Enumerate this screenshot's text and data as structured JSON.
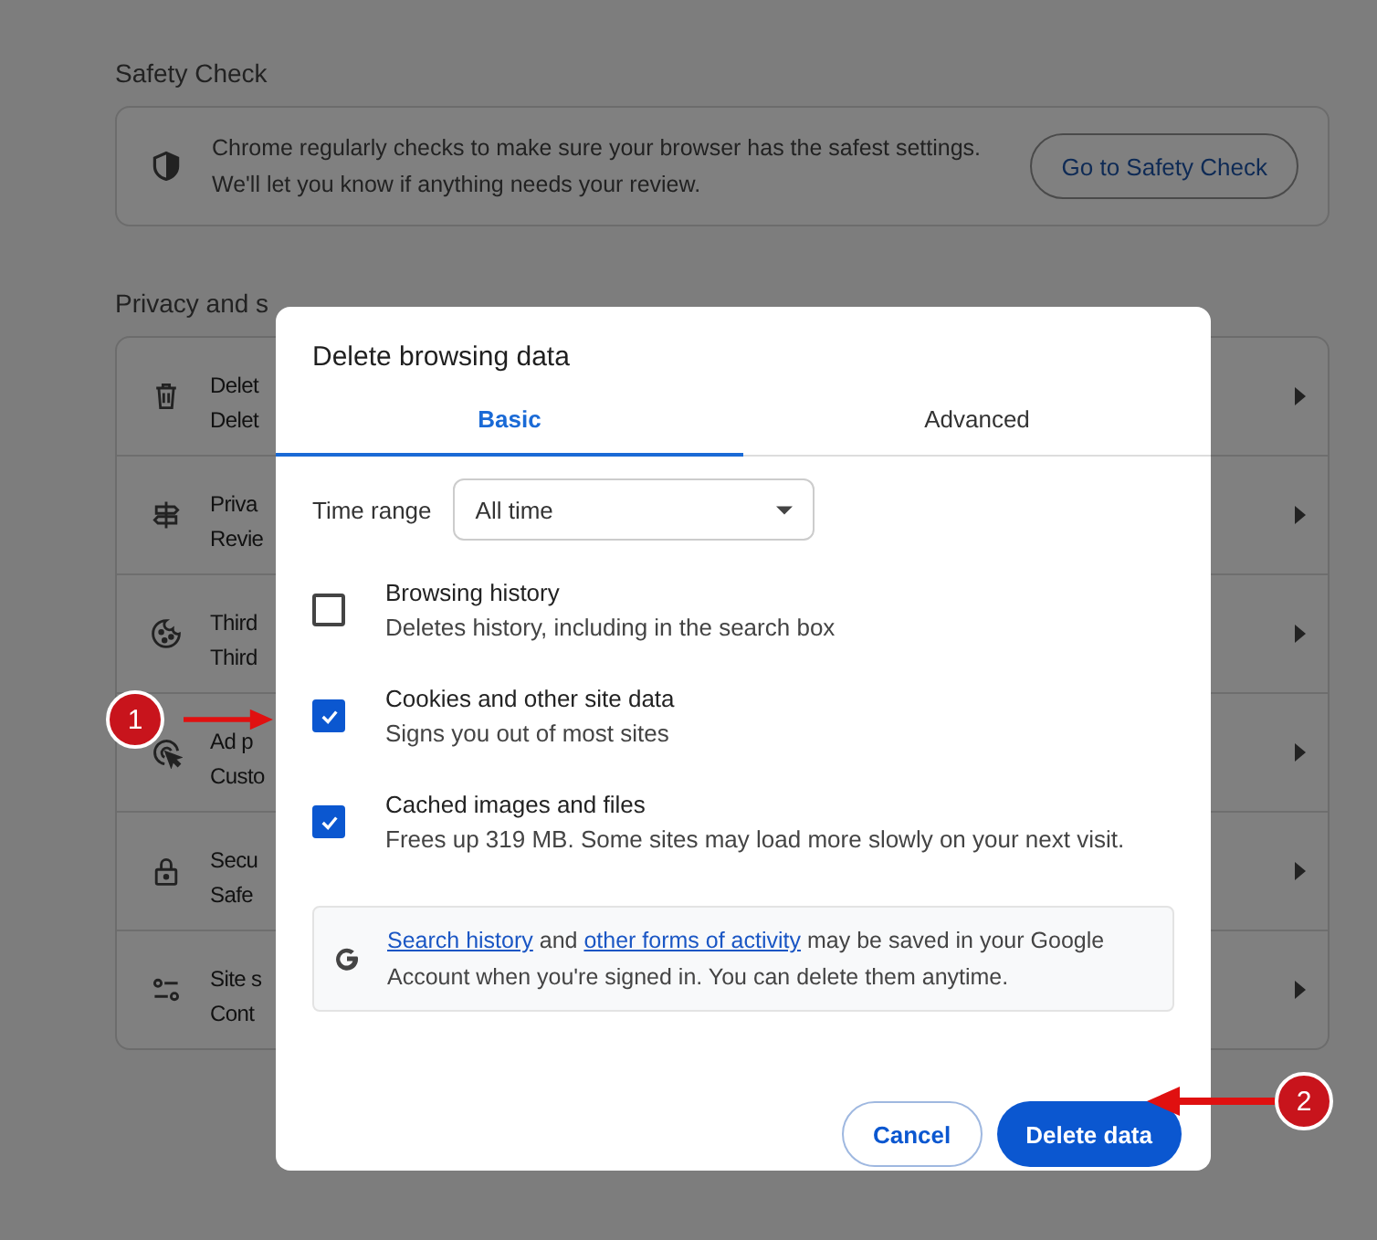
{
  "safety_check": {
    "heading": "Safety Check",
    "lines": [
      "Chrome regularly checks to make sure your browser has the safest settings.",
      "We'll let you know if anything needs your review."
    ],
    "button": "Go to Safety Check"
  },
  "privacy": {
    "heading": "Privacy and s",
    "rows": [
      {
        "kind": "trash",
        "title": "Delet",
        "subtitle": "Delet"
      },
      {
        "kind": "signpost",
        "title": "Priva",
        "subtitle": "Revie"
      },
      {
        "kind": "cookie",
        "title": "Third",
        "subtitle": "Third"
      },
      {
        "kind": "target",
        "title": "Ad p",
        "subtitle": "Custo"
      },
      {
        "kind": "lock",
        "title": "Secu",
        "subtitle": "Safe"
      },
      {
        "kind": "sliders",
        "title": "Site s",
        "subtitle": "Cont"
      }
    ]
  },
  "dialog": {
    "title": "Delete browsing data",
    "tabs": [
      {
        "label": "Basic",
        "selected": true
      },
      {
        "label": "Advanced",
        "selected": false
      }
    ],
    "time_range": {
      "label": "Time range",
      "value": "All time"
    },
    "options": [
      {
        "title": "Browsing history",
        "description": "Deletes history, including in the search box",
        "checked": false
      },
      {
        "title": "Cookies and other site data",
        "description": "Signs you out of most sites",
        "checked": true
      },
      {
        "title": "Cached images and files",
        "description": "Frees up 319 MB. Some sites may load more slowly on your next visit.",
        "checked": true
      }
    ],
    "info": {
      "parts": [
        {
          "text": "Search history",
          "link": true
        },
        {
          "text": " and ",
          "link": false
        },
        {
          "text": "other forms of activity",
          "link": true
        },
        {
          "text": " may be saved in your Google Account when you're signed in. You can delete them anytime.",
          "link": false
        }
      ]
    },
    "buttons": [
      {
        "label": "Cancel",
        "kind": "secondary"
      },
      {
        "label": "Delete data",
        "kind": "primary"
      }
    ]
  },
  "annotations": [
    {
      "label": "1"
    },
    {
      "label": "2"
    }
  ]
}
